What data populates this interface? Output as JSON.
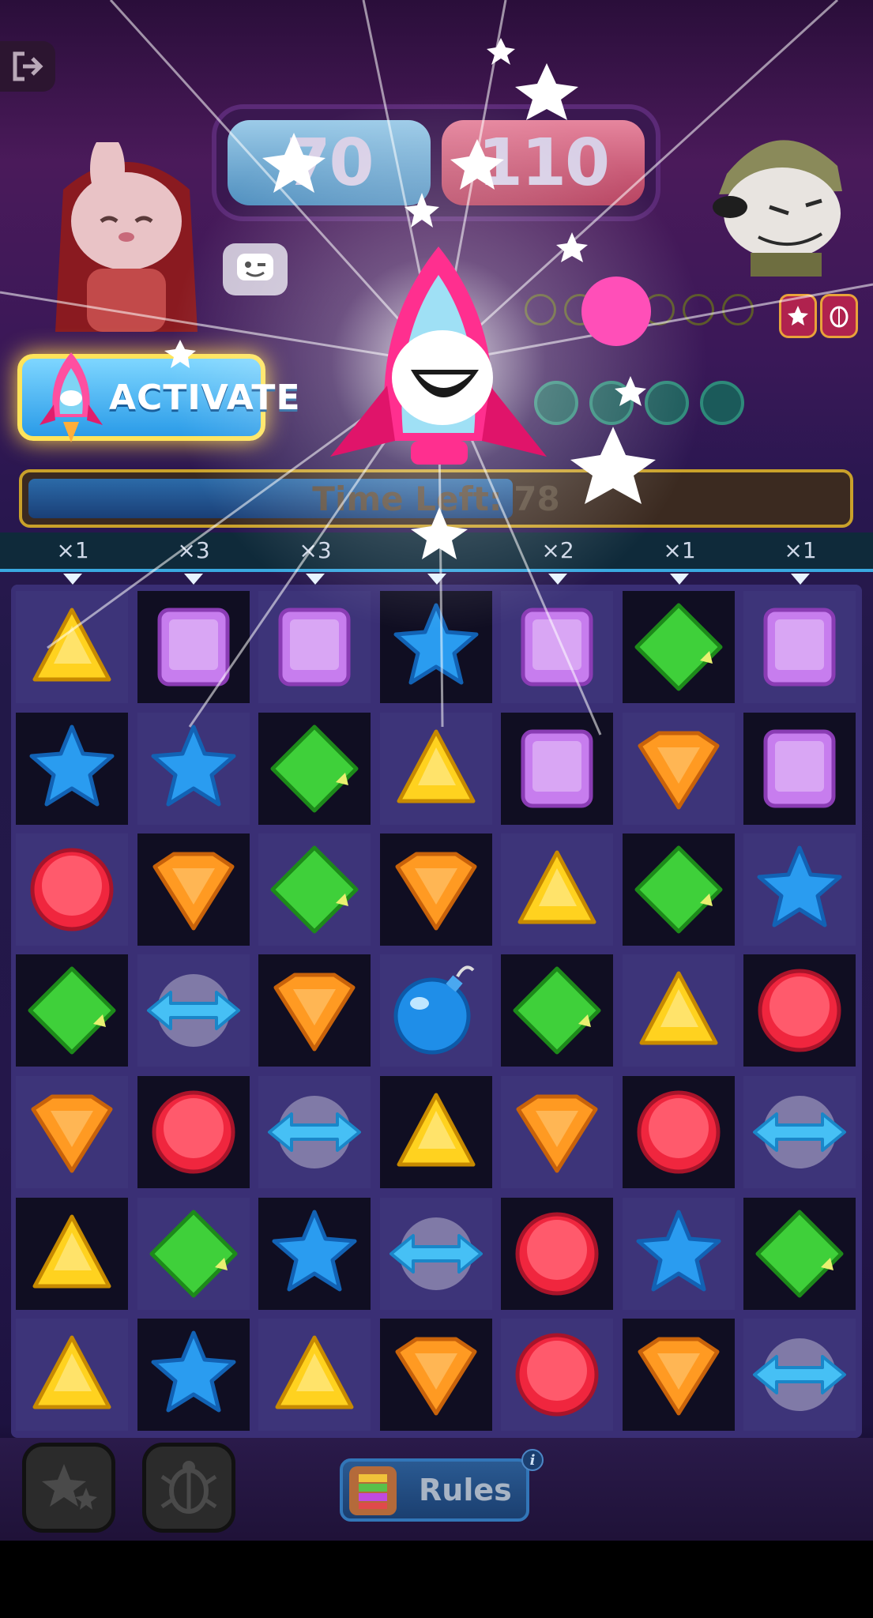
{
  "header": {
    "score_left": "70",
    "score_right": "110"
  },
  "activate": {
    "label": "ACTIVATE"
  },
  "timer": {
    "label": "Time Left: 78",
    "fraction_remaining": 0.6
  },
  "multipliers": [
    "×1",
    "×3",
    "×3",
    "",
    "×2",
    "×1",
    "×1"
  ],
  "board": {
    "rows": [
      [
        "triangle",
        "square",
        "square",
        "star",
        "square",
        "diamond",
        "square"
      ],
      [
        "star",
        "star",
        "diamond",
        "triangle",
        "square",
        "shield",
        "square"
      ],
      [
        "circle",
        "shield",
        "diamond",
        "shield",
        "triangle",
        "diamond",
        "star"
      ],
      [
        "diamond",
        "arrow",
        "shield",
        "bomb",
        "diamond",
        "triangle",
        "circle"
      ],
      [
        "shield",
        "circle",
        "arrow",
        "triangle",
        "shield",
        "circle",
        "arrow"
      ],
      [
        "triangle",
        "diamond",
        "star",
        "arrow",
        "circle",
        "star",
        "diamond"
      ],
      [
        "triangle",
        "star",
        "triangle",
        "shield",
        "circle",
        "shield",
        "arrow"
      ]
    ],
    "shading": [
      [
        0,
        1,
        0,
        1,
        0,
        1,
        0
      ],
      [
        1,
        0,
        1,
        0,
        1,
        0,
        1
      ],
      [
        0,
        1,
        0,
        1,
        0,
        1,
        0
      ],
      [
        1,
        0,
        1,
        0,
        1,
        0,
        1
      ],
      [
        0,
        1,
        0,
        1,
        0,
        1,
        0
      ],
      [
        1,
        0,
        1,
        0,
        1,
        0,
        1
      ],
      [
        0,
        1,
        0,
        1,
        0,
        1,
        0
      ]
    ],
    "gem_colors": {
      "triangle": "#ffd21f",
      "square": "#c77dee",
      "star": "#2a9cf0",
      "diamond": "#3fd03a",
      "shield": "#ff9a22",
      "circle": "#f0263e",
      "arrow": "#46c0f5",
      "bomb": "#1f8ee8"
    }
  },
  "bottom": {
    "rules_label": "Rules",
    "info_icon": "i"
  },
  "icons": [
    "exit-icon",
    "emote-icon",
    "rocket-icon",
    "star-booster-icon",
    "scarab-booster-icon",
    "rules-book-icon",
    "info-icon"
  ]
}
